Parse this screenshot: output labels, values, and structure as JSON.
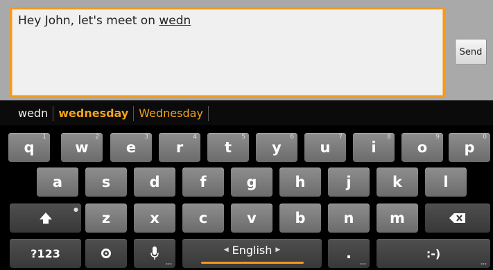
{
  "compose": {
    "text_prefix": "Hey John, let's meet on ",
    "text_current_word": "wedn",
    "send_label": "Send"
  },
  "suggestions": {
    "typed": "wedn",
    "primary": "wednesday",
    "alternate": "Wednesday"
  },
  "keyboard": {
    "row1": [
      {
        "label": "q",
        "num": "1"
      },
      {
        "label": "w",
        "num": "2"
      },
      {
        "label": "e",
        "num": "3"
      },
      {
        "label": "r",
        "num": "4"
      },
      {
        "label": "t",
        "num": "5"
      },
      {
        "label": "y",
        "num": "6"
      },
      {
        "label": "u",
        "num": "7"
      },
      {
        "label": "i",
        "num": "8"
      },
      {
        "label": "o",
        "num": "9"
      },
      {
        "label": "p",
        "num": "0"
      }
    ],
    "row2": [
      "a",
      "s",
      "d",
      "f",
      "g",
      "h",
      "j",
      "k",
      "l"
    ],
    "row3": [
      "z",
      "x",
      "c",
      "v",
      "b",
      "n",
      "m"
    ],
    "symbols_label": "?123",
    "space_label": "English",
    "period_label": ".",
    "smiley_label": ":-)",
    "colors": {
      "accent": "#f39a1e",
      "suggestion": "#f3a316"
    }
  }
}
